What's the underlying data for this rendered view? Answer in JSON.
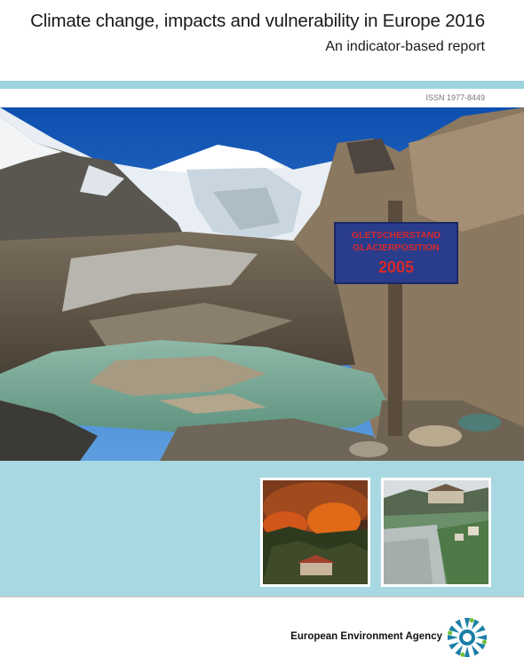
{
  "cover": {
    "title": "Climate change, impacts and vulnerability in Europe 2016",
    "subtitle": "An indicator-based report",
    "issn": "ISSN 1977-8449"
  },
  "main_photo": {
    "sign_line1": "GLETSCHERSTAND",
    "sign_line2": "GLACIERPOSITION",
    "sign_year": "2005"
  },
  "thumbnails": [
    {
      "name": "wildfire-photo"
    },
    {
      "name": "flood-photo"
    }
  ],
  "footer": {
    "agency_name": "European Environment Agency"
  },
  "colors": {
    "accent_teal": "#9ed2df",
    "lower_band": "#a8d9e3",
    "sign_blue": "#2a3c8c",
    "sign_red": "#d42a2a"
  }
}
